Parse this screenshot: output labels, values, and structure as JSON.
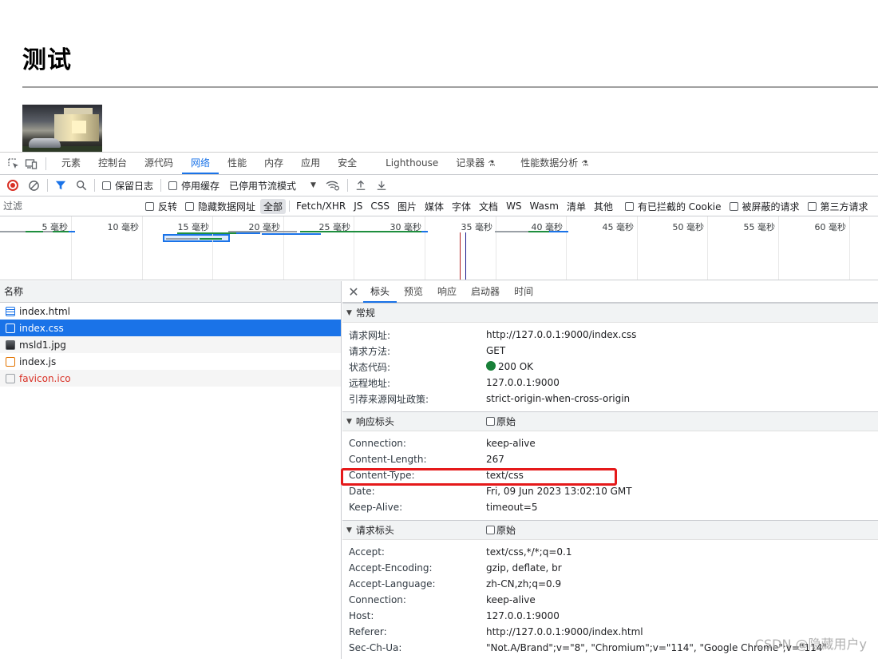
{
  "page": {
    "title": "测试"
  },
  "devtools": {
    "tabs": [
      "元素",
      "控制台",
      "源代码",
      "网络",
      "性能",
      "内存",
      "应用",
      "安全",
      "Lighthouse",
      "记录器",
      "性能数据分析"
    ],
    "toolbar": {
      "preserve_log": "保留日志",
      "disable_cache": "停用缓存",
      "throttle": "已停用节流模式"
    },
    "filter": {
      "placeholder": "过滤",
      "invert": "反转",
      "hide_data_urls": "隐藏数据网址",
      "types": [
        "全部",
        "Fetch/XHR",
        "JS",
        "CSS",
        "图片",
        "媒体",
        "字体",
        "文档",
        "WS",
        "Wasm",
        "清单",
        "其他"
      ],
      "blocked_cookies": "有已拦截的 Cookie",
      "blocked_requests": "被屏蔽的请求",
      "third_party": "第三方请求"
    },
    "overview": {
      "labels": [
        "5 毫秒",
        "10 毫秒",
        "15 毫秒",
        "20 毫秒",
        "25 毫秒",
        "30 毫秒",
        "35 毫秒",
        "40 毫秒",
        "45 毫秒",
        "50 毫秒",
        "55 毫秒",
        "60 毫秒"
      ]
    },
    "requests": {
      "header": "名称",
      "items": [
        {
          "name": "index.html",
          "icon": "document-icon"
        },
        {
          "name": "index.css",
          "icon": "stylesheet-icon"
        },
        {
          "name": "msld1.jpg",
          "icon": "image-icon"
        },
        {
          "name": "index.js",
          "icon": "script-icon"
        },
        {
          "name": "favicon.ico",
          "icon": "blank-file-icon"
        }
      ]
    },
    "details": {
      "tabs": [
        "标头",
        "预览",
        "响应",
        "启动器",
        "时间"
      ],
      "general": {
        "title": "常规",
        "rows": [
          {
            "k": "请求网址:",
            "v": "http://127.0.0.1:9000/index.css"
          },
          {
            "k": "请求方法:",
            "v": "GET"
          },
          {
            "k": "状态代码:",
            "v": "200 OK"
          },
          {
            "k": "远程地址:",
            "v": "127.0.0.1:9000"
          },
          {
            "k": "引荐来源网址政策:",
            "v": "strict-origin-when-cross-origin"
          }
        ]
      },
      "response_headers": {
        "title": "响应标头",
        "raw": "原始",
        "rows": [
          {
            "k": "Connection:",
            "v": "keep-alive"
          },
          {
            "k": "Content-Length:",
            "v": "267"
          },
          {
            "k": "Content-Type:",
            "v": "text/css"
          },
          {
            "k": "Date:",
            "v": "Fri, 09 Jun 2023 13:02:10 GMT"
          },
          {
            "k": "Keep-Alive:",
            "v": "timeout=5"
          }
        ]
      },
      "request_headers": {
        "title": "请求标头",
        "raw": "原始",
        "rows": [
          {
            "k": "Accept:",
            "v": "text/css,*/*;q=0.1"
          },
          {
            "k": "Accept-Encoding:",
            "v": "gzip, deflate, br"
          },
          {
            "k": "Accept-Language:",
            "v": "zh-CN,zh;q=0.9"
          },
          {
            "k": "Connection:",
            "v": "keep-alive"
          },
          {
            "k": "Host:",
            "v": "127.0.0.1:9000"
          },
          {
            "k": "Referer:",
            "v": "http://127.0.0.1:9000/index.html"
          },
          {
            "k": "Sec-Ch-Ua:",
            "v": "\"Not.A/Brand\";v=\"8\", \"Chromium\";v=\"114\", \"Google Chrome\";v=\"114\""
          }
        ]
      }
    }
  },
  "watermark": "CSDN @隐藏用户y",
  "colors": {
    "accent": "#1a73e8",
    "status_ok": "#188038",
    "error": "#d93025",
    "highlight_box": "#e5191a"
  }
}
